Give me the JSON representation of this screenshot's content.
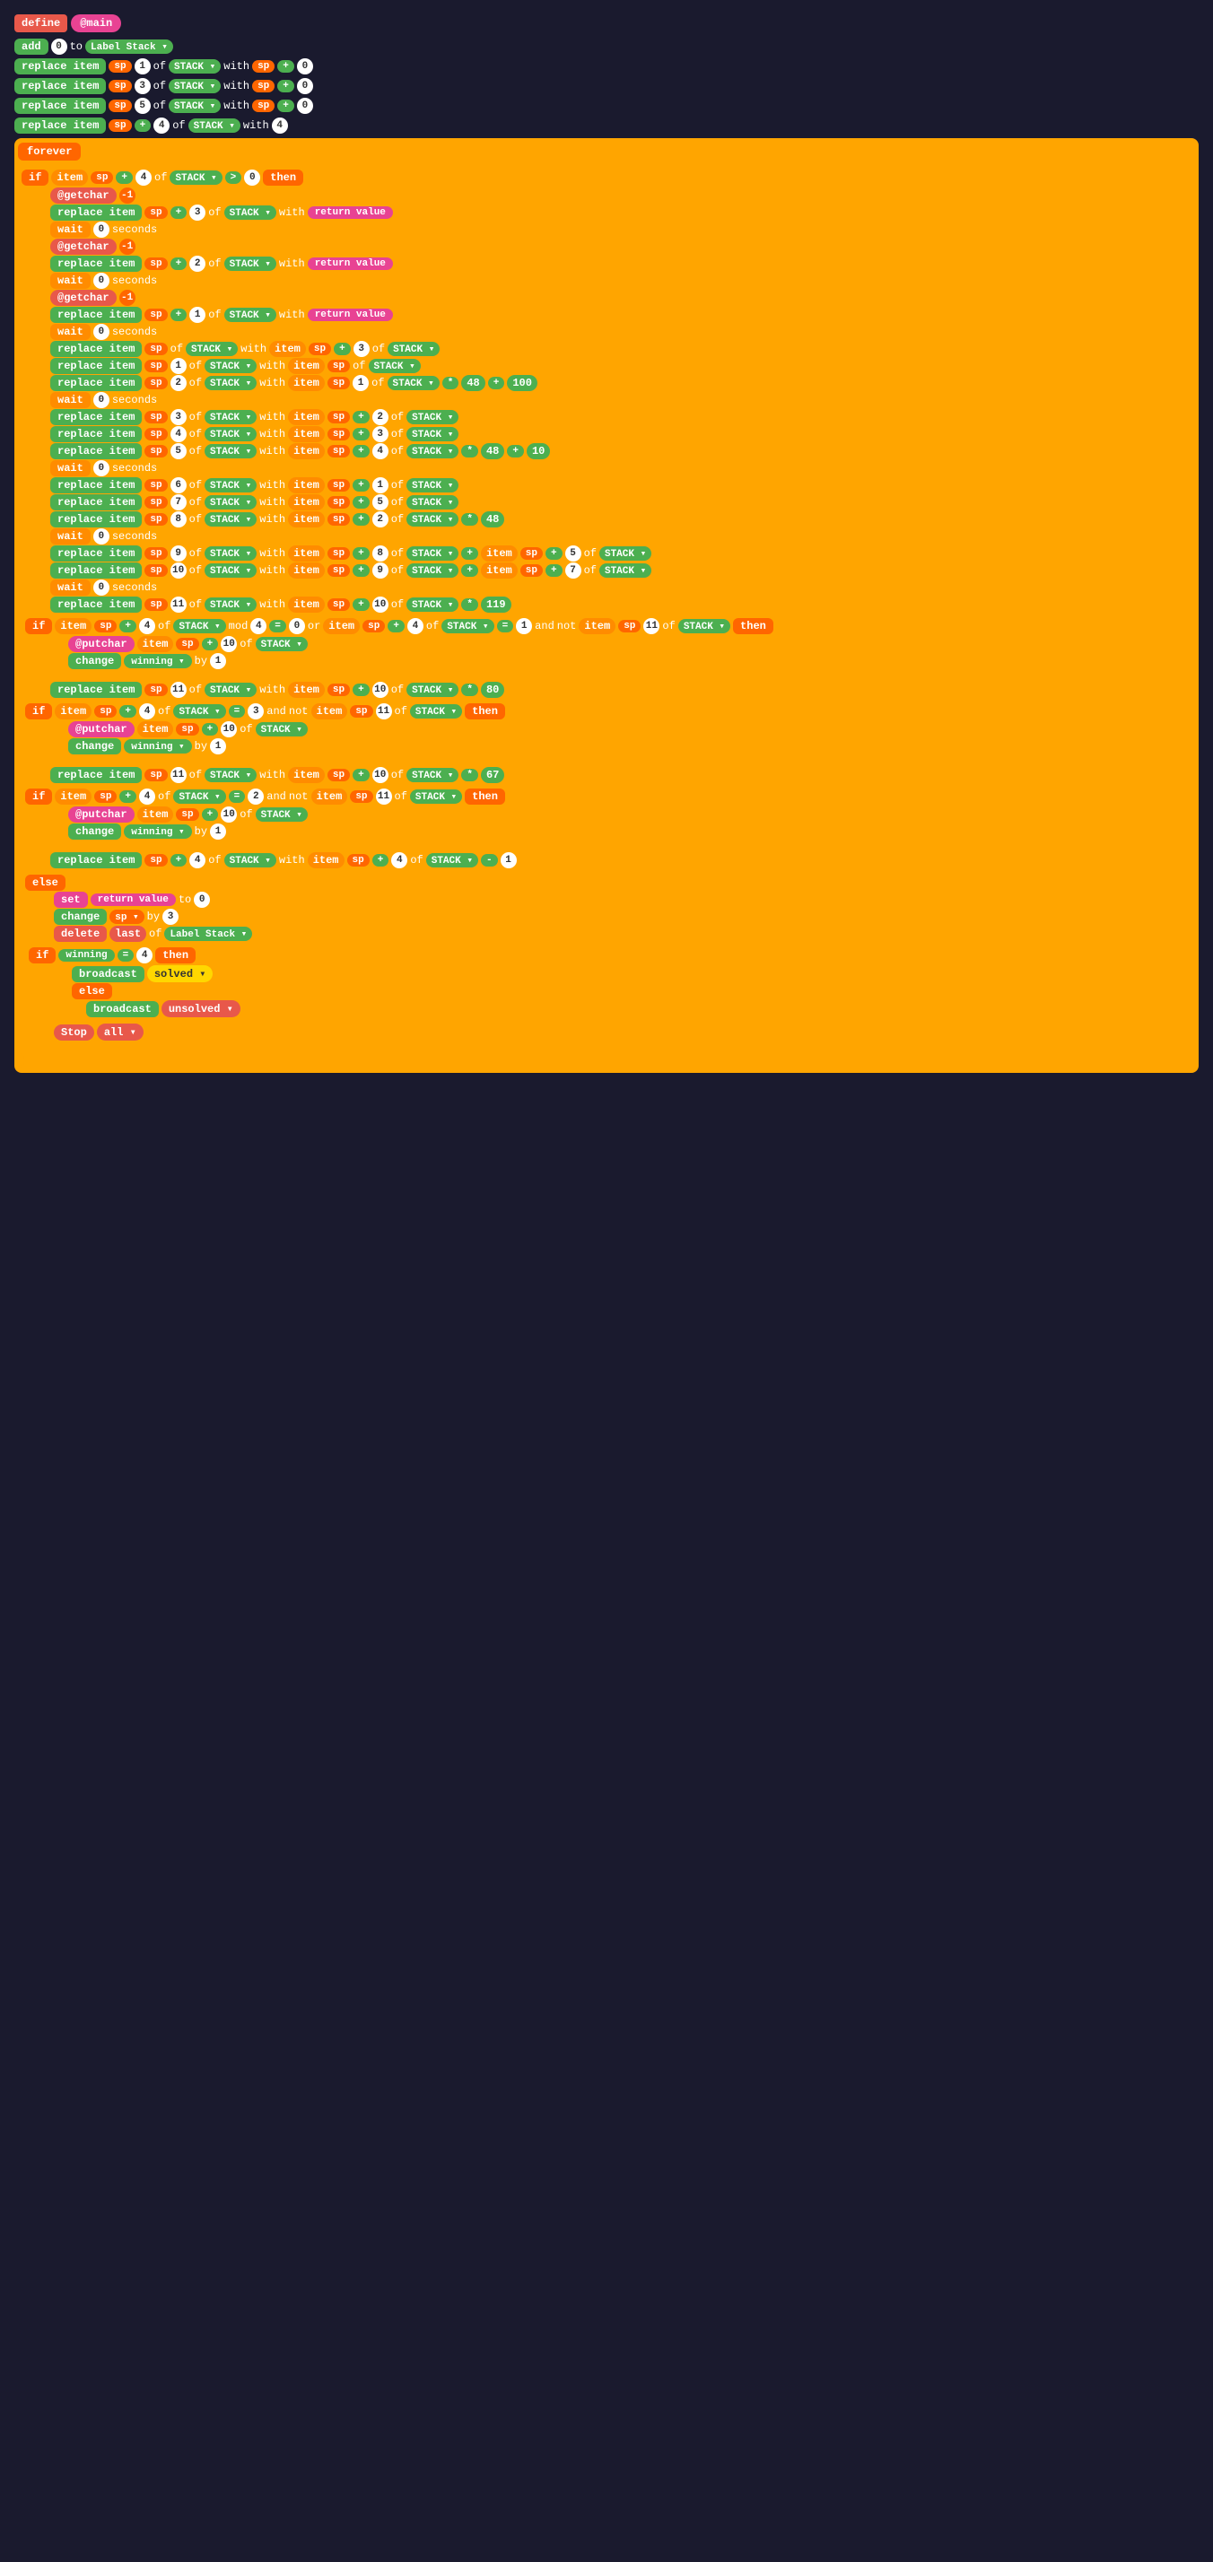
{
  "define": {
    "label": "define",
    "main": "@main"
  },
  "blocks": {
    "add": "add",
    "replace_item": "replace item",
    "forever": "forever",
    "if": "if",
    "then": "then",
    "else": "else",
    "wait": "wait",
    "seconds": "seconds",
    "of": "of",
    "with": "with",
    "by": "by",
    "and": "and",
    "or": "or",
    "not": "not",
    "mod": "mod",
    "to": "to",
    "item": "item",
    "set": "set",
    "change": "change",
    "delete": "delete",
    "last": "last",
    "broadcast": "broadcast",
    "stop": "Stop",
    "return_value": "return value",
    "sp": "sp",
    "stack": "STACK",
    "label_stack": "Label Stack",
    "winning": "winning",
    "solved": "solved",
    "unsolved": "unsolved",
    "all": "all"
  }
}
